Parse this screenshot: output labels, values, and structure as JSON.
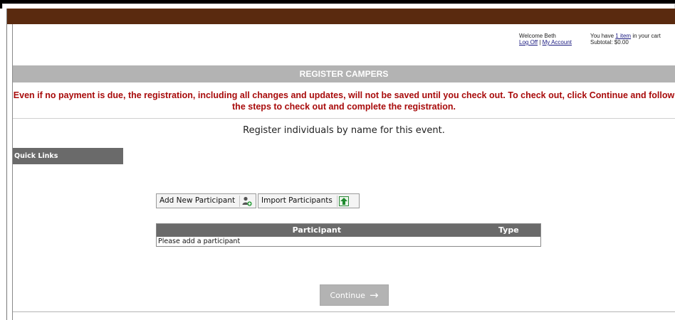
{
  "account": {
    "welcome": "Welcome Beth",
    "log_off": "Log Off",
    "separator": "|",
    "my_account": "My Account",
    "cart_prefix": "You have ",
    "cart_link": "1 item",
    "cart_suffix": " in your cart",
    "subtotal": "Subtotal: $0.00"
  },
  "section_title": "REGISTER CAMPERS",
  "warning_text": "Even if no payment is due, the registration, including all changes and updates, will not be saved until you check out. To check out, click Continue and follow the steps to check out and complete the registration.",
  "instruction": "Register individuals by name for this event.",
  "quick_links": "Quick Links",
  "buttons": {
    "add_participant": "Add New Participant",
    "import_participants": "Import Participants",
    "continue": "Continue",
    "continue_arrow": "→"
  },
  "table": {
    "headers": [
      "Participant",
      "Type"
    ],
    "empty_message": "Please add a participant"
  },
  "colors": {
    "header_band": "#5a2a0f",
    "section_bar": "#b3b3b3",
    "warning": "#a80b0b",
    "dark_bar": "#6a6a6a"
  }
}
